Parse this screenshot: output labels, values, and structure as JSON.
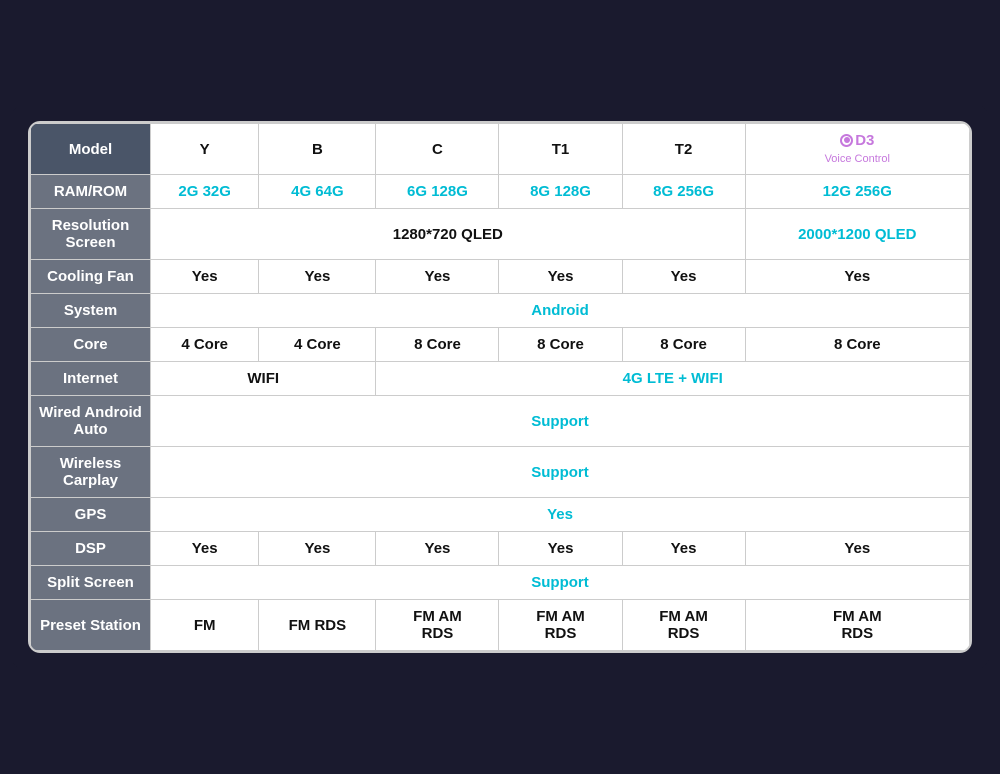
{
  "table": {
    "rows": [
      {
        "header": "Model",
        "header_bg": "#4a5568",
        "cells": [
          {
            "text": "Y",
            "type": "normal"
          },
          {
            "text": "B",
            "type": "normal"
          },
          {
            "text": "C",
            "type": "normal"
          },
          {
            "text": "T1",
            "type": "normal"
          },
          {
            "text": "T2",
            "type": "normal"
          },
          {
            "text": "D3",
            "type": "d3",
            "sub": "Voice Control"
          }
        ]
      },
      {
        "header": "RAM/ROM",
        "cells": [
          {
            "text": "2G 32G",
            "type": "cyan"
          },
          {
            "text": "4G 64G",
            "type": "cyan"
          },
          {
            "text": "6G 128G",
            "type": "cyan"
          },
          {
            "text": "8G 128G",
            "type": "cyan"
          },
          {
            "text": "8G 256G",
            "type": "cyan"
          },
          {
            "text": "12G 256G",
            "type": "cyan"
          }
        ]
      },
      {
        "header": "Resolution\nScreen",
        "cells": [
          {
            "text": "1280*720 QLED",
            "type": "normal",
            "colspan": 5
          },
          {
            "text": "2000*1200 QLED",
            "type": "cyan"
          }
        ]
      },
      {
        "header": "Cooling Fan",
        "cells": [
          {
            "text": "Yes",
            "type": "normal"
          },
          {
            "text": "Yes",
            "type": "normal"
          },
          {
            "text": "Yes",
            "type": "normal"
          },
          {
            "text": "Yes",
            "type": "normal"
          },
          {
            "text": "Yes",
            "type": "normal"
          },
          {
            "text": "Yes",
            "type": "normal"
          }
        ]
      },
      {
        "header": "System",
        "cells": [
          {
            "text": "Android",
            "type": "cyan",
            "colspan": 6
          }
        ]
      },
      {
        "header": "Core",
        "cells": [
          {
            "text": "4 Core",
            "type": "normal"
          },
          {
            "text": "4 Core",
            "type": "normal"
          },
          {
            "text": "8 Core",
            "type": "normal"
          },
          {
            "text": "8 Core",
            "type": "normal"
          },
          {
            "text": "8 Core",
            "type": "normal"
          },
          {
            "text": "8 Core",
            "type": "normal"
          }
        ]
      },
      {
        "header": "Internet",
        "cells": [
          {
            "text": "WIFI",
            "type": "normal",
            "colspan": 2
          },
          {
            "text": "4G LTE + WIFI",
            "type": "cyan",
            "colspan": 4
          }
        ]
      },
      {
        "header": "Wired Android\nAuto",
        "cells": [
          {
            "text": "Support",
            "type": "cyan",
            "colspan": 6
          }
        ]
      },
      {
        "header": "Wireless\nCarplay",
        "cells": [
          {
            "text": "Support",
            "type": "cyan",
            "colspan": 6
          }
        ]
      },
      {
        "header": "GPS",
        "cells": [
          {
            "text": "Yes",
            "type": "cyan",
            "colspan": 6
          }
        ]
      },
      {
        "header": "DSP",
        "cells": [
          {
            "text": "Yes",
            "type": "normal"
          },
          {
            "text": "Yes",
            "type": "normal"
          },
          {
            "text": "Yes",
            "type": "normal"
          },
          {
            "text": "Yes",
            "type": "normal"
          },
          {
            "text": "Yes",
            "type": "normal"
          },
          {
            "text": "Yes",
            "type": "normal"
          }
        ]
      },
      {
        "header": "Split Screen",
        "cells": [
          {
            "text": "Support",
            "type": "cyan",
            "colspan": 6
          }
        ]
      },
      {
        "header": "Preset Station",
        "cells": [
          {
            "text": "FM",
            "type": "normal"
          },
          {
            "text": "FM RDS",
            "type": "normal"
          },
          {
            "text": "FM AM\nRDS",
            "type": "normal"
          },
          {
            "text": "FM AM\nRDS",
            "type": "normal"
          },
          {
            "text": "FM AM\nRDS",
            "type": "normal"
          },
          {
            "text": "FM AM\nRDS",
            "type": "normal"
          }
        ]
      }
    ]
  }
}
